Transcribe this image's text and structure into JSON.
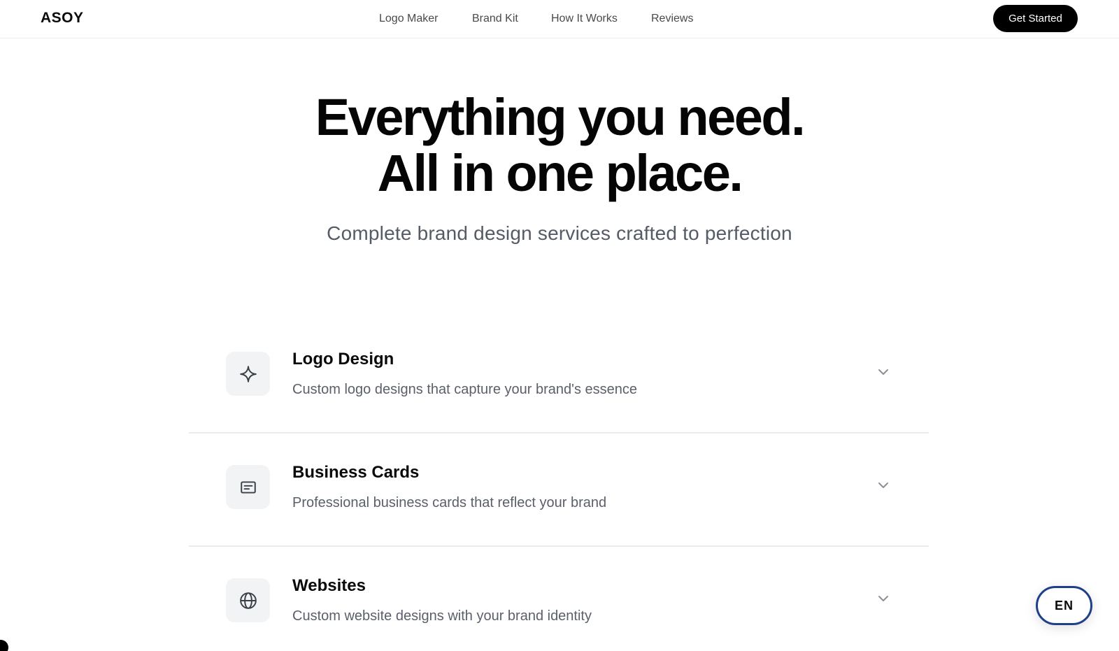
{
  "header": {
    "brand": "ASOY",
    "nav": [
      "Logo Maker",
      "Brand Kit",
      "How It Works",
      "Reviews"
    ],
    "cta_label": "Get Started"
  },
  "hero": {
    "title_line1": "Everything you need.",
    "title_line2": "All in one place.",
    "subtitle": "Complete brand design services crafted to perfection"
  },
  "services": [
    {
      "icon": "sparkle-icon",
      "title": "Logo Design",
      "description": "Custom logo designs that capture your brand's essence"
    },
    {
      "icon": "card-icon",
      "title": "Business Cards",
      "description": "Professional business cards that reflect your brand"
    },
    {
      "icon": "globe-icon",
      "title": "Websites",
      "description": "Custom website designs with your brand identity"
    }
  ],
  "language": {
    "label": "EN"
  },
  "colors": {
    "primary": "#000000",
    "accent_border": "#1f3f8a",
    "icon_bg": "#f2f3f5",
    "muted_text": "#5a5f69"
  }
}
